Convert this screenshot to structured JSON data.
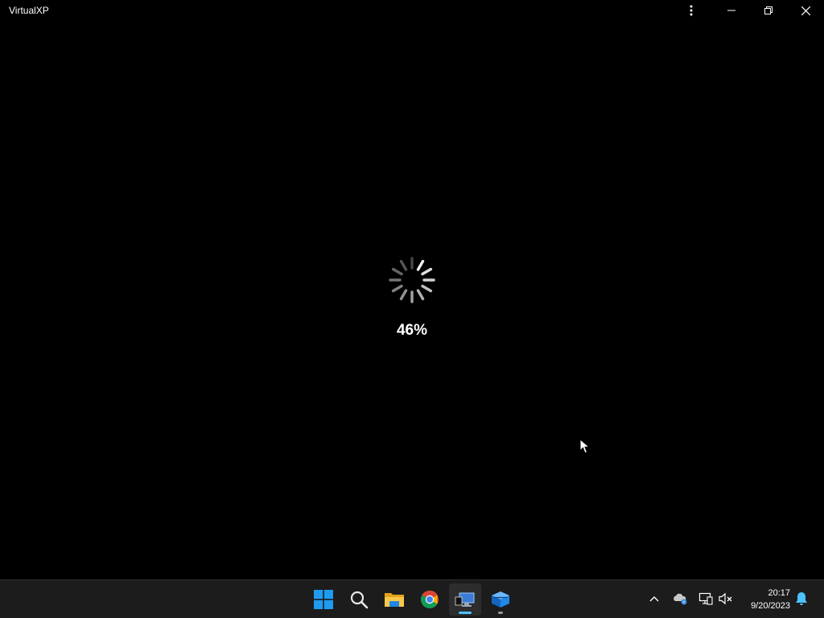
{
  "window": {
    "title": "VirtualXP",
    "controls": {
      "more": "more-options-icon",
      "minimize": "minimize-icon",
      "maximize": "restore-icon",
      "close": "close-icon"
    }
  },
  "loading": {
    "progress_text": "46%",
    "progress_fraction": 0.46
  },
  "taskbar": {
    "apps": [
      {
        "name": "start",
        "icon": "windows-logo-icon"
      },
      {
        "name": "search",
        "icon": "search-icon"
      },
      {
        "name": "file-explorer",
        "icon": "folder-icon"
      },
      {
        "name": "chrome",
        "icon": "chrome-icon"
      },
      {
        "name": "remote-desktop",
        "icon": "remote-desktop-icon",
        "active": true
      },
      {
        "name": "virtualbox",
        "icon": "cube-icon",
        "open": true
      }
    ],
    "tray": {
      "icons": [
        "chevron-up-icon",
        "onedrive-icon",
        "network-icon",
        "volume-muted-icon"
      ],
      "time": "20:17",
      "date": "9/20/2023",
      "notification": "bell-icon"
    }
  },
  "colors": {
    "background": "#000000",
    "taskbar": "#1c1c1c",
    "accent": "#4cc2ff"
  }
}
